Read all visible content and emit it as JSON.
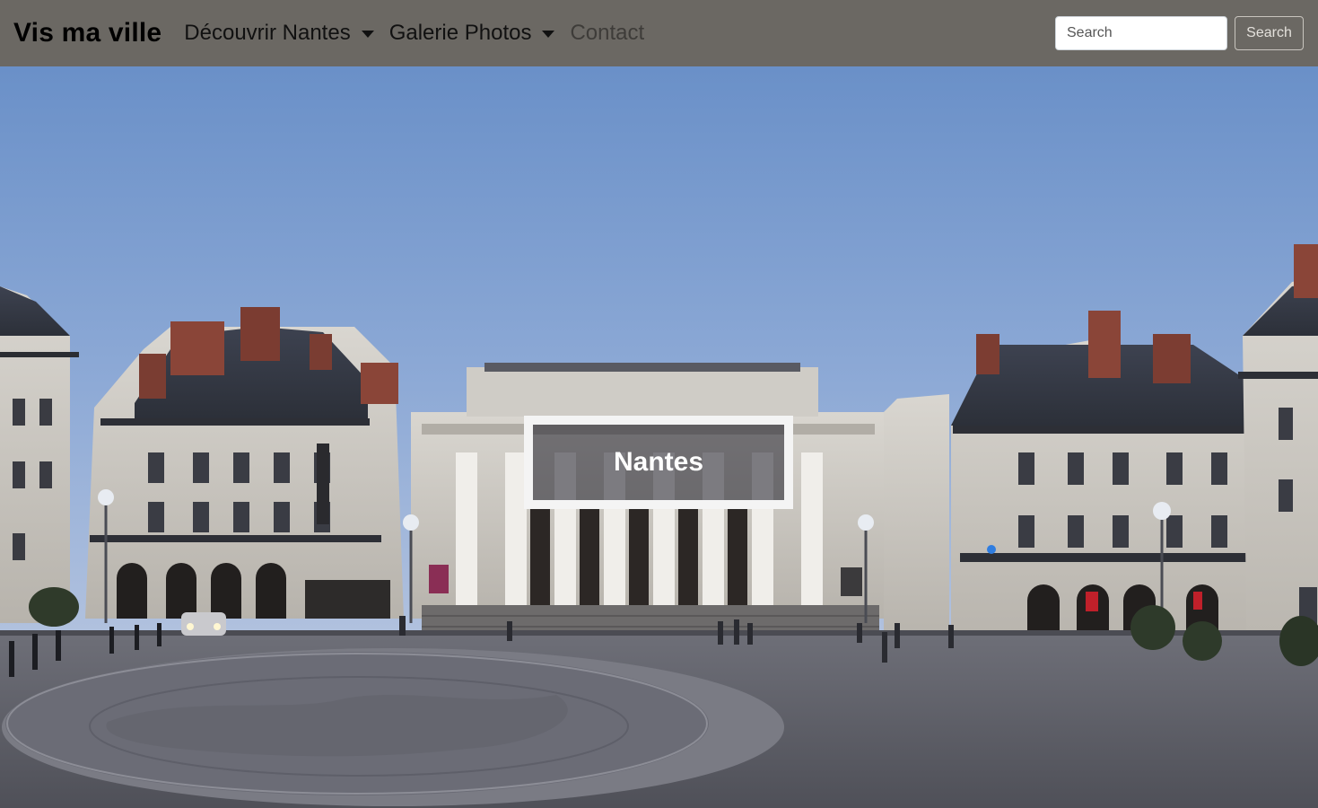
{
  "navbar": {
    "brand": "Vis ma ville",
    "items": [
      {
        "label": "Découvrir Nantes",
        "dropdown": true
      },
      {
        "label": "Galerie Photos",
        "dropdown": true
      },
      {
        "label": "Contact",
        "dropdown": false
      }
    ],
    "search": {
      "placeholder": "Search",
      "button_label": "Search"
    }
  },
  "hero": {
    "title": "Nantes",
    "image_alt": "Place Graslin et le Théâtre Graslin à Nantes au crépuscule"
  },
  "colors": {
    "navbar_bg": "#6b6863",
    "sky_top": "#6a90c8",
    "sky_bottom": "#a9bedf",
    "pavement": "#5d5e66"
  }
}
